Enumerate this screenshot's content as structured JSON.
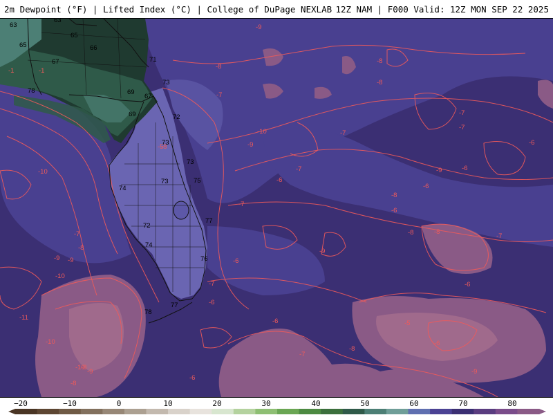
{
  "header": {
    "left_title": "2m Dewpoint (°F) | Lifted Index (°C) | College of DuPage NEXLAB",
    "right_title": "12Z NAM | F000 Valid: 12Z MON SEP 22 2025"
  },
  "colors": {
    "ocean_base": "#3b2f73",
    "ocean_light": "#4b4294",
    "ocean_pale": "#5d58a8",
    "florida_land": "#6a65b2",
    "north_land_dark": "#1f3a30",
    "north_land_mid": "#2f5a49",
    "north_land_light": "#4c7f75",
    "unstable_pink": "#8a5a86",
    "unstable_light": "#a06a8c",
    "contour": "#f05a5a",
    "state_lines": "#111111"
  },
  "map_labels": {
    "dewpoint": [
      "63",
      "63",
      "65",
      "65",
      "66",
      "67",
      "67",
      "69",
      "69",
      "71",
      "73",
      "72",
      "73",
      "73",
      "73",
      "75",
      "74",
      "72",
      "74",
      "77",
      "76",
      "77",
      "78",
      "78"
    ],
    "lifted_index": [
      "-9",
      "-8",
      "-8",
      "-7",
      "-10",
      "-9",
      "-10",
      "-9",
      "-7",
      "-6",
      "-7",
      "-7",
      "-6",
      "-9",
      "-8",
      "-7",
      "-6",
      "-6",
      "-8",
      "-7",
      "-6",
      "-6",
      "-7",
      "-6",
      "-9",
      "-8",
      "-7",
      "-6",
      "-5",
      "-5",
      "-8",
      "-9",
      "-8",
      "-9",
      "-10",
      "-11",
      "-10",
      "-8",
      "-10",
      "-9",
      "-8",
      "-6",
      "-8",
      "-7",
      "-7",
      "-6",
      "-8",
      "-6",
      "-1",
      "-1"
    ]
  },
  "colorbar": {
    "ticks": [
      "−20",
      "−10",
      "0",
      "10",
      "20",
      "30",
      "40",
      "50",
      "60",
      "70",
      "80"
    ],
    "stops": [
      "#4a3524",
      "#5d4632",
      "#6f5a45",
      "#82705d",
      "#978776",
      "#aca091",
      "#c3b9ae",
      "#d9d2ca",
      "#e8e3dd",
      "#d8e6cf",
      "#b4d29e",
      "#8ebf73",
      "#6aa653",
      "#4c8a41",
      "#3b6f3c",
      "#2f5a49",
      "#4c7f75",
      "#6f9e98",
      "#5f6fb0",
      "#4b4294",
      "#3b2f73",
      "#5a3d80",
      "#7a4c8a",
      "#8a5a86"
    ]
  }
}
